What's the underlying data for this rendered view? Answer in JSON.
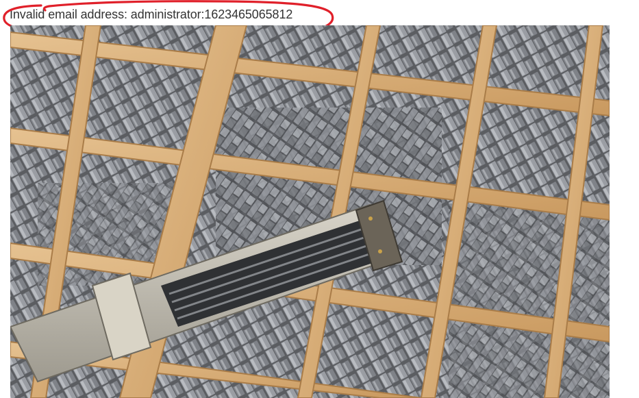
{
  "message": {
    "text": "Invalid email address: administrator:1623465065812"
  },
  "annotation": {
    "color": "#e0202a"
  },
  "image": {
    "subject_icon": "letterpress-type-case-image",
    "colors": {
      "wood": "#d9b07a",
      "wood_shadow": "#a97c48",
      "metal_type": "#8d9096",
      "metal_dark": "#3f4246",
      "composing_stick": "#c7c3b8"
    }
  }
}
